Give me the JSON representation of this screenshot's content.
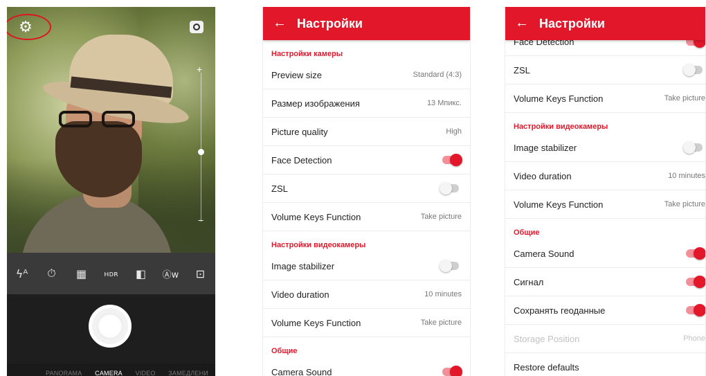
{
  "camera": {
    "modes": [
      "PANORAMA",
      "CAMERA",
      "VIDEO",
      "ЗАМЕДЛЕНИ"
    ],
    "active_mode": "CAMERA",
    "toolbar_icons": [
      "flash-auto-icon",
      "timer-off-icon",
      "grid-icon",
      "hdr-off-icon",
      "aspect-ratio-icon",
      "white-balance-auto-icon",
      "scene-auto-icon"
    ],
    "toolbar_glyphs": [
      "ϟᴬ",
      "⏱",
      "▦",
      "ʜᴅʀ",
      "◧",
      "Ⓐᴡ",
      "⊡"
    ],
    "zoom_plus": "+",
    "zoom_minus": "−",
    "zoom_level": 0.47,
    "highlight_color": "#e0141e"
  },
  "settings1": {
    "title": "Настройки",
    "sections": {
      "camera": "Настройки камеры",
      "video": "Настройки видеокамеры",
      "general": "Общие"
    },
    "rows": {
      "preview_size": {
        "label": "Preview size",
        "value": "Standard (4:3)"
      },
      "image_size": {
        "label": "Размер изображения",
        "value": "13 Мпикс."
      },
      "picture_quality": {
        "label": "Picture quality",
        "value": "High"
      },
      "face_detection": {
        "label": "Face Detection",
        "on": true
      },
      "zsl": {
        "label": "ZSL",
        "on": false
      },
      "volume_keys": {
        "label": "Volume Keys Function",
        "value": "Take picture"
      },
      "image_stabilizer": {
        "label": "Image stabilizer",
        "on": false
      },
      "video_duration": {
        "label": "Video duration",
        "value": "10 minutes"
      },
      "volume_keys_video": {
        "label": "Volume Keys Function",
        "value": "Take picture"
      },
      "camera_sound": {
        "label": "Camera Sound",
        "on": true
      }
    }
  },
  "settings2": {
    "title": "Настройки",
    "sections": {
      "video": "Настройки видеокамеры",
      "general": "Общие"
    },
    "rows": {
      "face_detection_partial": {
        "label": "Face Detection",
        "on": true
      },
      "zsl": {
        "label": "ZSL",
        "on": false
      },
      "volume_keys": {
        "label": "Volume Keys Function",
        "value": "Take picture"
      },
      "image_stabilizer": {
        "label": "Image stabilizer",
        "on": false
      },
      "video_duration": {
        "label": "Video duration",
        "value": "10 minutes"
      },
      "volume_keys_video": {
        "label": "Volume Keys Function",
        "value": "Take picture"
      },
      "camera_sound": {
        "label": "Camera Sound",
        "on": true
      },
      "signal": {
        "label": "Сигнал",
        "on": true
      },
      "geodata": {
        "label": "Сохранять геоданные",
        "on": true
      },
      "storage_position": {
        "label": "Storage Position",
        "value": "Phone"
      },
      "restore_defaults": {
        "label": "Restore defaults"
      }
    }
  },
  "colors": {
    "accent": "#e3172a",
    "toggle_on_track": "#f28f98",
    "toggle_off_track": "#cfcfcf"
  }
}
